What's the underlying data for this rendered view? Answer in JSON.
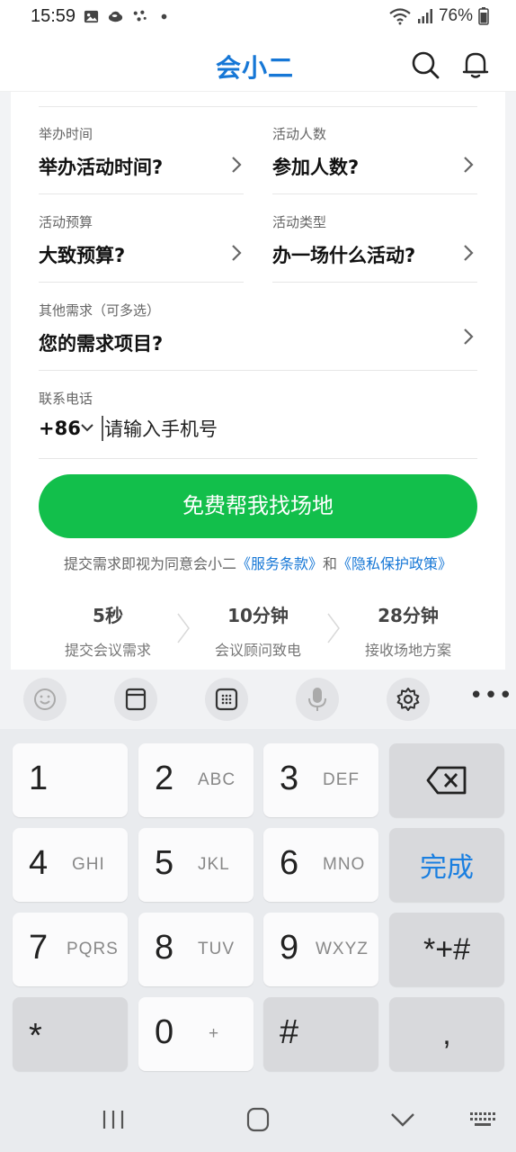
{
  "status_bar": {
    "time": "15:59",
    "battery": "76%",
    "left_icons": [
      "gallery-icon",
      "weather-icon",
      "dots-app-icon",
      "dot-icon"
    ],
    "right_icons": [
      "wifi-icon",
      "signal-icon",
      "battery-icon"
    ]
  },
  "header": {
    "logo": "会小二",
    "icons": [
      "search-icon",
      "bell-icon"
    ],
    "brand_color": "#1677d6"
  },
  "form": {
    "time": {
      "label": "举办时间",
      "value": "举办活动时间?"
    },
    "people": {
      "label": "活动人数",
      "value": "参加人数?"
    },
    "budget": {
      "label": "活动预算",
      "value": "大致预算?"
    },
    "type": {
      "label": "活动类型",
      "value": "办一场什么活动?"
    },
    "other": {
      "label": "其他需求（可多选）",
      "value": "您的需求项目?"
    },
    "phone": {
      "label": "联系电话",
      "code": "+86",
      "placeholder": "请输入手机号"
    },
    "submit_label": "免费帮我找场地",
    "submit_color": "#12bf4b"
  },
  "agreement": {
    "prefix": "提交需求即视为同意会小二",
    "terms": "《服务条款》",
    "and": "和",
    "privacy": "《隐私保护政策》"
  },
  "steps": [
    {
      "value": "5秒",
      "desc": "提交会议需求"
    },
    {
      "value": "10分钟",
      "desc": "会议顾问致电"
    },
    {
      "value": "28分钟",
      "desc": "接收场地方案"
    }
  ],
  "keyboard": {
    "toolbar": [
      "emoji-icon",
      "clipboard-icon",
      "keypad-icon",
      "mic-icon",
      "settings-icon",
      "more-icon"
    ],
    "more": "•••",
    "keys": [
      {
        "main": "1",
        "sub": ""
      },
      {
        "main": "2",
        "sub": "ABC"
      },
      {
        "main": "3",
        "sub": "DEF"
      },
      {
        "main": "4",
        "sub": "GHI"
      },
      {
        "main": "5",
        "sub": "JKL"
      },
      {
        "main": "6",
        "sub": "MNO"
      },
      {
        "main": "7",
        "sub": "PQRS"
      },
      {
        "main": "8",
        "sub": "TUV"
      },
      {
        "main": "9",
        "sub": "WXYZ"
      },
      {
        "main": "0",
        "sub": "+"
      }
    ],
    "done": "完成",
    "symbols": "*+#",
    "star": "*",
    "hash": "#",
    "comma": ","
  },
  "nav": [
    "recent-apps-icon",
    "home-icon",
    "back-icon",
    "keyboard-switch-icon"
  ]
}
